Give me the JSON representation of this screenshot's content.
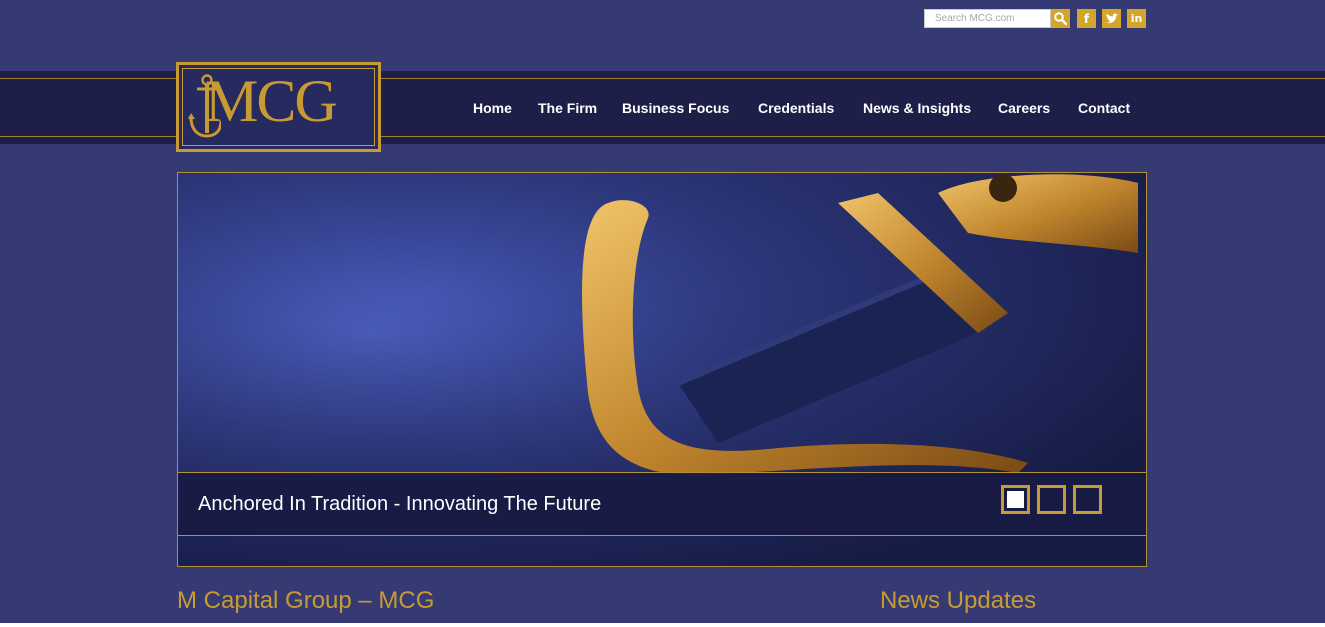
{
  "search": {
    "placeholder": "Search MCG.com"
  },
  "social": {
    "facebook": "f",
    "twitter_icon": "twitter-bird-icon",
    "linkedin": "in"
  },
  "logo": {
    "text": "MCG"
  },
  "nav": {
    "items": [
      {
        "label": "Home"
      },
      {
        "label": "The Firm"
      },
      {
        "label": "Business Focus"
      },
      {
        "label": "Credentials"
      },
      {
        "label": "News & Insights"
      },
      {
        "label": "Careers"
      },
      {
        "label": "Contact"
      }
    ]
  },
  "hero": {
    "caption": "Anchored In Tradition - Innovating The Future",
    "slides_count": 3,
    "active_slide": 1
  },
  "sections": {
    "left_heading": "M Capital Group – MCG",
    "right_heading": "News Updates"
  },
  "colors": {
    "background": "#363a73",
    "header": "#1d1f48",
    "gold": "#c79b34"
  }
}
